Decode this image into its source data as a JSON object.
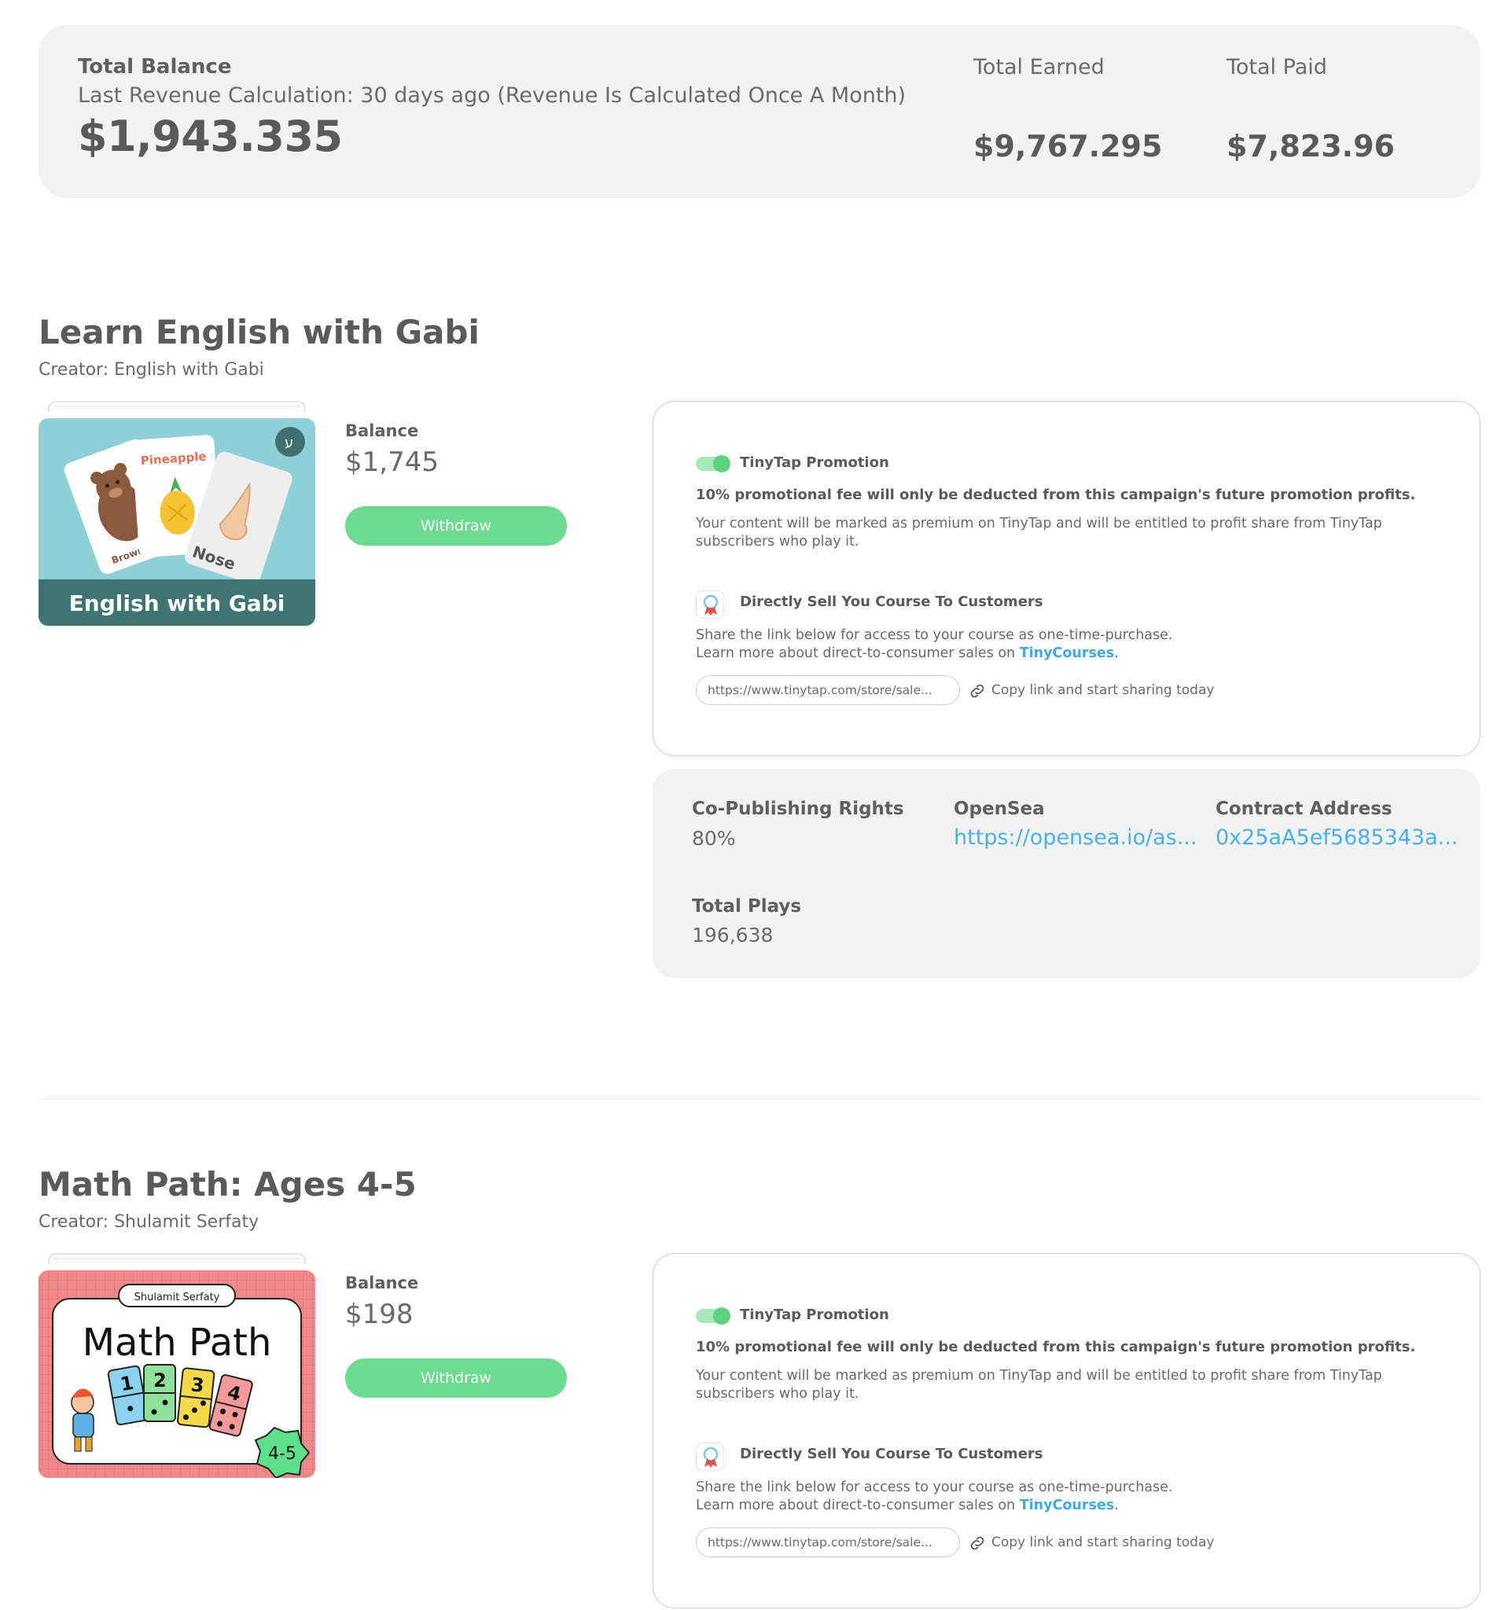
{
  "summary": {
    "total_balance_label": "Total Balance",
    "last_calc": "Last Revenue Calculation: 30 days ago (Revenue Is Calculated Once A Month)",
    "total_balance": "$1,943.335",
    "total_earned_label": "Total Earned",
    "total_earned": "$9,767.295",
    "total_paid_label": "Total Paid",
    "total_paid": "$7,823.96"
  },
  "campaigns": [
    {
      "title": "Learn English with Gabi",
      "creator": "Creator: English with Gabi",
      "cover": {
        "title": "English with Gabi",
        "card_pineapple": "Pineapple",
        "card_bear": "Brown Bear",
        "card_nose": "Nose",
        "badge": "ע"
      },
      "balance_label": "Balance",
      "balance": "$1,745",
      "withdraw": "Withdraw",
      "promotion": {
        "title": "TinyTap Promotion",
        "fee_note": "10% promotional fee will only be deducted from this campaign's future promotion profits.",
        "description": "Your content will be marked as premium on TinyTap and will be entitled to profit share from TinyTap subscribers who play it.",
        "direct_title": "Directly Sell You Course To Customers",
        "direct_line1": "Share the link below for access to your course as one-time-purchase.",
        "direct_line2": "Learn more about direct-to-consumer sales on ",
        "direct_link": "TinyCourses",
        "url": "https://www.tinytap.com/store/sale...",
        "copy_text": "Copy link and start sharing today"
      },
      "rights": {
        "copub_label": "Co-Publishing Rights",
        "copub_value": "80%",
        "opensea_label": "OpenSea",
        "opensea_value": "https://opensea.io/as...",
        "contract_label": "Contract Address",
        "contract_value": "0x25aA5ef5685343a...",
        "plays_label": "Total Plays",
        "plays_value": "196,638"
      }
    },
    {
      "title": "Math Path: Ages 4-5",
      "creator": "Creator: Shulamit Serfaty",
      "cover": {
        "title": "Math Path",
        "author": "Shulamit Serfaty",
        "age": "4-5",
        "digits": [
          "1",
          "2",
          "3",
          "4"
        ]
      },
      "balance_label": "Balance",
      "balance": "$198",
      "withdraw": "Withdraw",
      "promotion": {
        "title": "TinyTap Promotion",
        "fee_note": "10% promotional fee will only be deducted from this campaign's future promotion profits.",
        "description": "Your content will be marked as premium on TinyTap and will be entitled to profit share from TinyTap subscribers who play it.",
        "direct_title": "Directly Sell You Course To Customers",
        "direct_line1": "Share the link below for access to your course as one-time-purchase.",
        "direct_line2": "Learn more about direct-to-consumer sales on ",
        "direct_link": "TinyCourses",
        "url": "https://www.tinytap.com/store/sale...",
        "copy_text": "Copy link and start sharing today"
      }
    }
  ],
  "colors": {
    "accent_green": "#6ddb8f",
    "link_blue": "#3fa9e8",
    "card_gray": "#f2f2f2"
  }
}
